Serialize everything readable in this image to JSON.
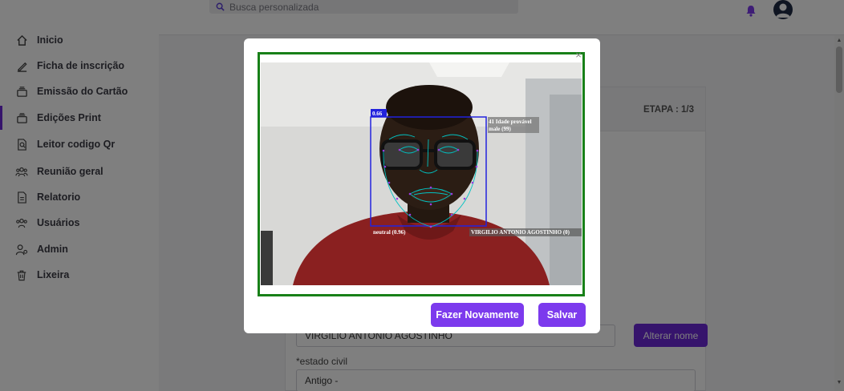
{
  "search": {
    "placeholder": "Busca personalizada"
  },
  "sidebar": {
    "items": [
      {
        "label": "Inicio",
        "icon": "home-icon"
      },
      {
        "label": "Ficha de inscrição",
        "icon": "pen-icon"
      },
      {
        "label": "Emissão do Cartão",
        "icon": "card-stack-icon"
      },
      {
        "label": "Edições Print",
        "icon": "card-stack-icon",
        "active": true
      },
      {
        "label": "Leitor codigo Qr",
        "icon": "document-search-icon"
      },
      {
        "label": "Reunião geral",
        "icon": "group-icon"
      },
      {
        "label": "Relatorio",
        "icon": "document-icon"
      },
      {
        "label": "Usuários",
        "icon": "users-icon"
      },
      {
        "label": "Admin",
        "icon": "admin-icon"
      },
      {
        "label": "Lixeira",
        "icon": "trash-icon"
      }
    ]
  },
  "card": {
    "etapa": "ETAPA : 1/3",
    "name_value": "VIRGILIO ANTONIO AGOSTINHO",
    "rename_button": "Alterar nome",
    "estado_civil_label": "*estado civil",
    "estado_civil_value": "Antigo -"
  },
  "modal": {
    "detection": {
      "confidence": "0.66",
      "age_line": "41 Idade provável",
      "gender_line": "male (99)",
      "expression": "neutral (0.96)",
      "identity": "VIRGILIO ANTONIO AGOSTINHO (0)"
    },
    "retry_button": "Fazer Novamente",
    "save_button": "Salvar",
    "close_glyph": "×"
  },
  "colors": {
    "accent": "#7c3aed",
    "frame_green": "#188018",
    "box_blue": "#2222dd",
    "landmark": "#8a2be2"
  }
}
